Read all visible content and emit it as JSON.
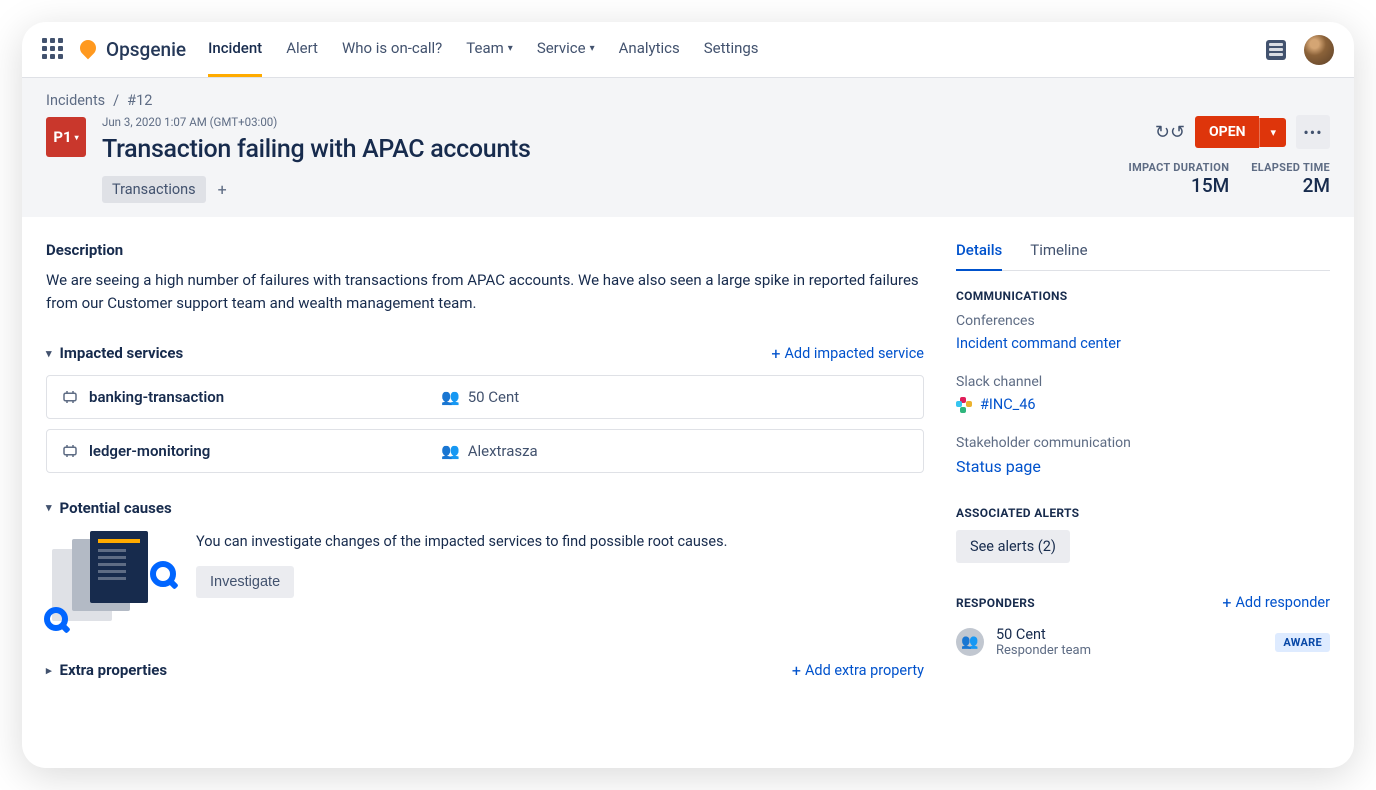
{
  "nav": {
    "logo": "Opsgenie",
    "tabs": [
      "Incident",
      "Alert",
      "Who is on-call?",
      "Team",
      "Service",
      "Analytics",
      "Settings"
    ]
  },
  "breadcrumb": {
    "parent": "Incidents",
    "current": "#12"
  },
  "header": {
    "priority": "P1",
    "timestamp": "Jun 3, 2020 1:07 AM (GMT+03:00)",
    "title": "Transaction failing with APAC accounts",
    "tag": "Transactions",
    "status": "OPEN",
    "impact_label": "IMPACT DURATION",
    "impact_value": "15M",
    "elapsed_label": "ELAPSED TIME",
    "elapsed_value": "2M"
  },
  "description": {
    "heading": "Description",
    "text": "We are seeing a high number of failures with transactions from APAC accounts. We have also seen a large spike in reported failures from our Customer support team and wealth management team."
  },
  "impacted": {
    "heading": "Impacted services",
    "add": "Add impacted service",
    "rows": [
      {
        "name": "banking-transaction",
        "team": "50 Cent"
      },
      {
        "name": "ledger-monitoring",
        "team": "Alextrasza"
      }
    ]
  },
  "causes": {
    "heading": "Potential causes",
    "text": "You can investigate changes of the impacted services to find possible root causes.",
    "cta": "Investigate"
  },
  "extra": {
    "heading": "Extra properties",
    "add": "Add extra property"
  },
  "side": {
    "tabs": {
      "details": "Details",
      "timeline": "Timeline"
    },
    "comms_h": "COMMUNICATIONS",
    "conferences": "Conferences",
    "icc": "Incident command center",
    "slack_label": "Slack channel",
    "slack_value": "#INC_46",
    "stake_label": "Stakeholder communication",
    "stake_value": "Status page",
    "alerts_h": "ASSOCIATED ALERTS",
    "alerts_chip": "See alerts (2)",
    "resp_h": "RESPONDERS",
    "resp_add": "Add responder",
    "responder_name": "50 Cent",
    "responder_sub": "Responder team",
    "aware": "AWARE"
  }
}
